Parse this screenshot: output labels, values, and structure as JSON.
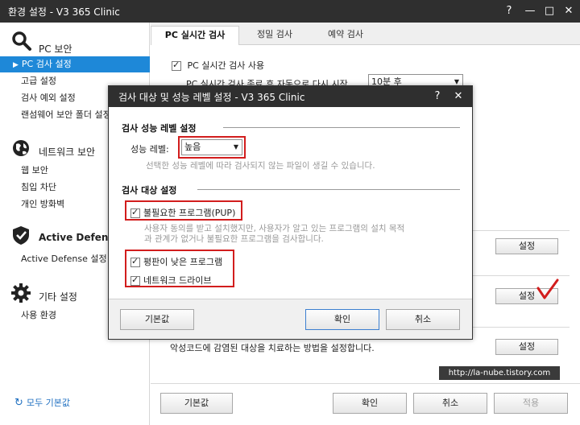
{
  "window": {
    "title": "환경 설정 - V3 365 Clinic",
    "help": "?",
    "minimize": "—",
    "maximize": "□",
    "close": "✕"
  },
  "sidebar": {
    "pc_security": {
      "label": "PC 보안",
      "icon": "magnifier-icon",
      "items": [
        "PC 검사 설정",
        "고급 설정",
        "검사 예외 설정",
        "랜섬웨어 보안 폴더 설정"
      ]
    },
    "network_security": {
      "label": "네트워크 보안",
      "icon": "globe-icon",
      "items": [
        "웹 보안",
        "침입 차단",
        "개인 방화벽"
      ]
    },
    "active_defense": {
      "label": "Active Defense",
      "icon": "shield-check-icon",
      "items": [
        "Active Defense 설정"
      ]
    },
    "other": {
      "label": "기타 설정",
      "icon": "gear-icon",
      "items": [
        "사용 환경"
      ]
    },
    "reset_all": "모두 기본값"
  },
  "tabs": [
    "PC 실시간 검사",
    "정밀 검사",
    "예약 검사"
  ],
  "content": {
    "realtime_use_label": "PC 실시간 검사 사용",
    "realtime_use_checked": true,
    "auto_restart_label": "PC 실시간 검사 종료 후 자동으로 다시 시작",
    "auto_restart_value": "10분 후",
    "settings_btn_1": "설정",
    "settings_btn_2": "설정",
    "settings_btn_3": "설정",
    "cure_desc": "악성코드에 감염된 대상을 치료하는 방법을 설정합니다."
  },
  "footer": {
    "default_btn": "기본값",
    "ok_btn": "확인",
    "cancel_btn": "취소",
    "apply_btn": "적용"
  },
  "dialog": {
    "title": "검사 대상 및 성능 레벨 설정 - V3 365 Clinic",
    "help": "?",
    "close": "✕",
    "performance_section": "검사 성능 레벨 설정",
    "performance_label": "성능 레벨:",
    "performance_value": "높음",
    "performance_desc": "선택한 성능 레벨에 따라 검사되지 않는 파일이 생길 수 있습니다.",
    "target_section": "검사 대상 설정",
    "options": [
      {
        "label": "불필요한 프로그램(PUP)",
        "checked": true
      },
      {
        "label": "평판이 낮은 프로그램",
        "checked": true
      },
      {
        "label": "네트워크 드라이브",
        "checked": true
      }
    ],
    "pup_desc_1": "사용자 동의를 받고 설치했지만, 사용자가 알고 있는 프로그램의 설치 목적",
    "pup_desc_2": "과 관계가 없거나 불필요한 프로그램을 검사합니다.",
    "default_btn": "기본값",
    "ok_btn": "확인",
    "cancel_btn": "취소"
  },
  "watermark": "http://la-nube.tistory.com",
  "colors": {
    "titlebar": "#2f2f2f",
    "accent": "#1e88d8",
    "highlight_red": "#d21d1d"
  }
}
